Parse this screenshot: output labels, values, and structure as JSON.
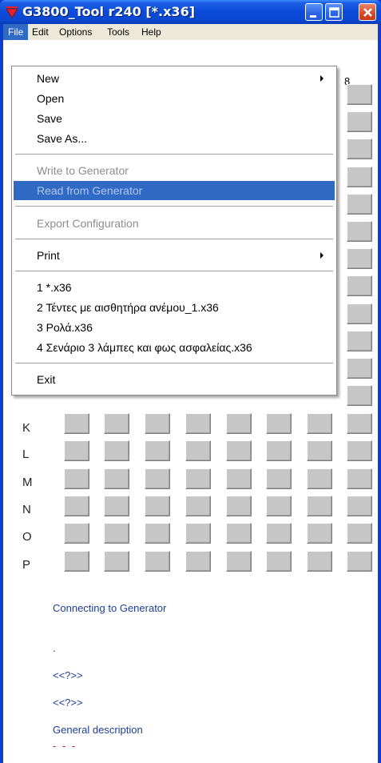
{
  "window": {
    "title": "G3800_Tool r240 [*.x36]",
    "icons": {
      "app": "red-triangle-icon",
      "minimize": "minimize-icon",
      "maximize": "maximize-icon",
      "close": "close-icon"
    }
  },
  "menubar": {
    "items": [
      {
        "label": "File",
        "active": true
      },
      {
        "label": "Edit"
      },
      {
        "label": "Options"
      },
      {
        "label": "Tools"
      },
      {
        "label": "Help"
      }
    ]
  },
  "file_menu": {
    "new": "New",
    "open": "Open",
    "save": "Save",
    "save_as": "Save As...",
    "write_to_generator": "Write to Generator",
    "read_from_generator": "Read from Generator",
    "export_configuration": "Export Configuration",
    "print": "Print",
    "recent": [
      "1 *.x36",
      "2 Τέντες με αισθητήρα ανέμου_1.x36",
      "3 Ρολά.x36",
      "4 Σενάριο 3 λάμπες και φως ασφαλείας.x36"
    ],
    "exit": "Exit"
  },
  "grid": {
    "visible_column_header": "8",
    "visible_row_headers": [
      "K",
      "L",
      "M",
      "N",
      "O",
      "P"
    ]
  },
  "status": {
    "connection": "Connecting to Generator",
    "dot": ".",
    "placeholder_1": "<<?>>",
    "placeholder_2": "<<?>>",
    "description_label": "General description",
    "description_value": "- - -"
  },
  "colors": {
    "title_bar": "#0a4ad8",
    "menu_highlight": "#316ac5",
    "status_text": "#1c3f99",
    "description_value": "#e01010"
  }
}
